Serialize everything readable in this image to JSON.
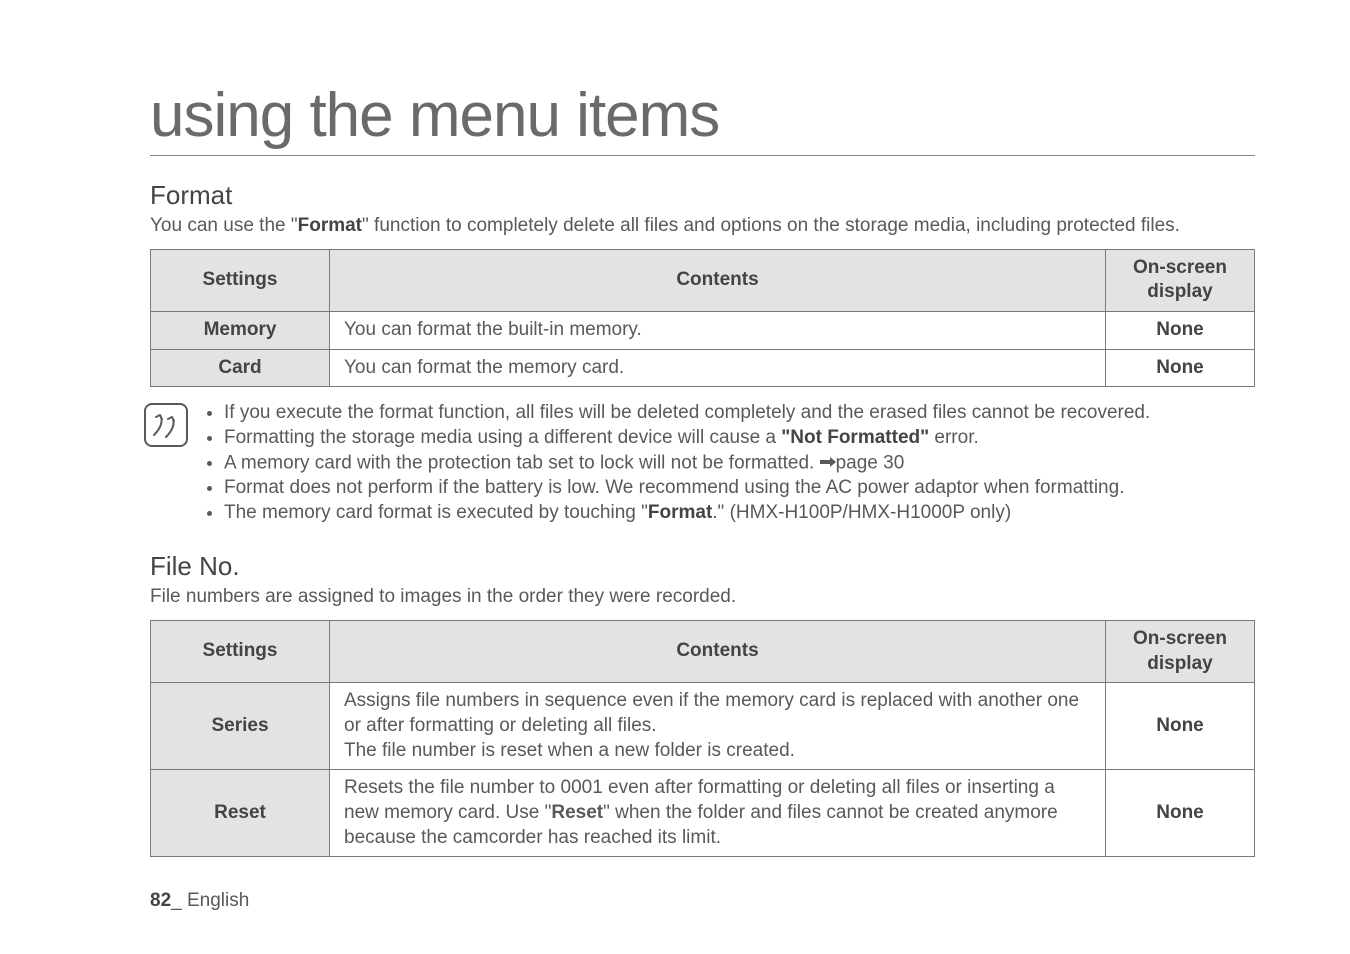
{
  "title": "using the menu items",
  "section_format": {
    "heading": "Format",
    "intro_pre": "You can use the \"",
    "intro_bold": "Format",
    "intro_post": "\" function to completely delete all files and options on the storage media, including protected files.",
    "headers": {
      "settings": "Settings",
      "contents": "Contents",
      "display": "On-screen display"
    },
    "rows": {
      "memory": {
        "label": "Memory",
        "content": "You can format the built-in memory.",
        "display": "None"
      },
      "card": {
        "label": "Card",
        "content": "You can format the memory card.",
        "display": "None"
      }
    }
  },
  "notes": {
    "n1": "If you execute the format function, all files will be deleted completely and the erased files cannot be recovered.",
    "n2_pre": "Formatting the storage media using a different device will cause a ",
    "n2_bold": "\"Not Formatted\"",
    "n2_post": " error.",
    "n3_pre": "A memory card with the protection tab set to lock will not be formatted. ",
    "n3_post": "page 30",
    "n4": "Format does not perform if the battery is low. We recommend using the AC power adaptor when formatting.",
    "n5_pre": "The memory card format is executed by touching \"",
    "n5_bold": "Format",
    "n5_post": ".\" (HMX-H100P/HMX-H1000P only)"
  },
  "section_file": {
    "heading": "File No.",
    "intro": "File numbers are assigned to images in the order they were recorded.",
    "headers": {
      "settings": "Settings",
      "contents": "Contents",
      "display": "On-screen display"
    },
    "rows": {
      "series": {
        "label": "Series",
        "content": "Assigns file numbers in sequence even if the memory card is replaced with another one or after formatting or deleting all files.\nThe file number is reset when a new folder is created.",
        "display": "None"
      },
      "reset": {
        "label": "Reset",
        "content_pre": "Resets the file number to 0001 even after formatting or deleting all files or inserting a new memory card. Use \"",
        "content_bold": "Reset",
        "content_post": "\" when the folder and files cannot be created anymore because the camcorder has reached its limit.",
        "display": "None"
      }
    }
  },
  "footer": {
    "page": "82",
    "sep": "_ ",
    "lang": "English"
  }
}
